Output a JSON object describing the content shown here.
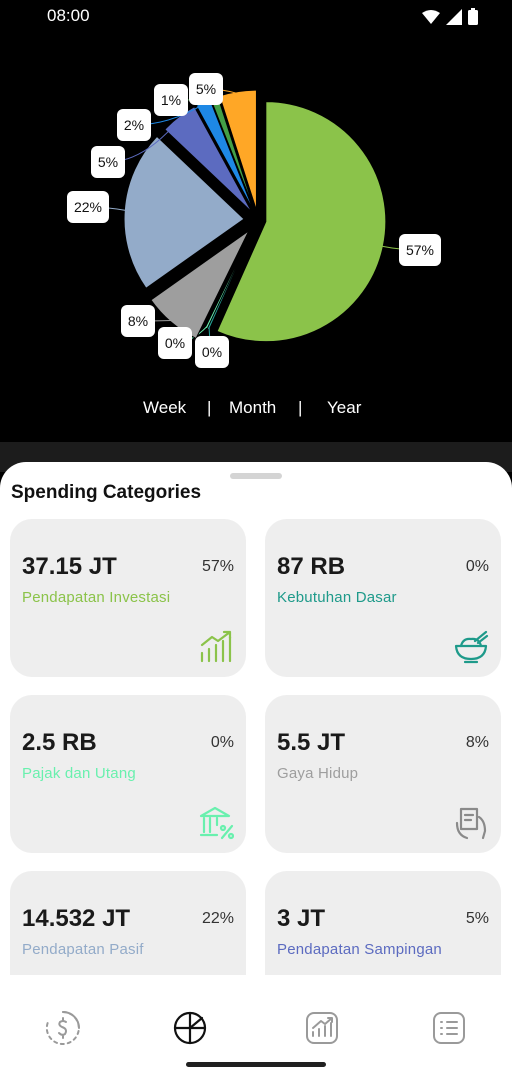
{
  "status_bar": {
    "time": "08:00"
  },
  "chart_data": {
    "type": "pie",
    "slices": [
      {
        "label": "57%",
        "value": 57,
        "color": "#8bc34a"
      },
      {
        "label": "0%",
        "value": 0.3,
        "color": "#26a69a"
      },
      {
        "label": "0%",
        "value": 0.3,
        "color": "#69f0ae"
      },
      {
        "label": "8%",
        "value": 8,
        "color": "#9e9e9e"
      },
      {
        "label": "22%",
        "value": 22,
        "color": "#93abc9"
      },
      {
        "label": "5%",
        "value": 5,
        "color": "#5c6bc0"
      },
      {
        "label": "2%",
        "value": 2,
        "color": "#1e88e5"
      },
      {
        "label": "1%",
        "value": 1,
        "color": "#43a047"
      },
      {
        "label": "5%",
        "value": 5,
        "color": "#ffa726"
      }
    ]
  },
  "period_selector": {
    "week": "Week",
    "month": "Month",
    "year": "Year",
    "separator": "|"
  },
  "sheet": {
    "title": "Spending Categories"
  },
  "cards": [
    {
      "amount": "37.15 JT",
      "percent": "57%",
      "name": "Pendapatan Investasi",
      "color": "#8bc34a",
      "icon": "chart-growth-icon"
    },
    {
      "amount": "87 RB",
      "percent": "0%",
      "name": "Kebutuhan Dasar",
      "color": "#1e9a8a",
      "icon": "rice-bowl-icon"
    },
    {
      "amount": "2.5 RB",
      "percent": "0%",
      "name": "Pajak dan Utang",
      "color": "#69f0ae",
      "icon": "bank-tax-icon"
    },
    {
      "amount": "5.5 JT",
      "percent": "8%",
      "name": "Gaya Hidup",
      "color": "#9e9e9e",
      "icon": "shopping-hand-icon"
    },
    {
      "amount": "14.532 JT",
      "percent": "22%",
      "name": "Pendapatan Pasif",
      "color": "#93abc9",
      "icon": ""
    },
    {
      "amount": "3 JT",
      "percent": "5%",
      "name": "Pendapatan Sampingan",
      "color": "#5c6bc0",
      "icon": ""
    }
  ],
  "nav": [
    {
      "icon": "dollar-cycle-icon",
      "active": false
    },
    {
      "icon": "pie-chart-icon",
      "active": true
    },
    {
      "icon": "trend-chart-icon",
      "active": false
    },
    {
      "icon": "list-icon",
      "active": false
    }
  ]
}
